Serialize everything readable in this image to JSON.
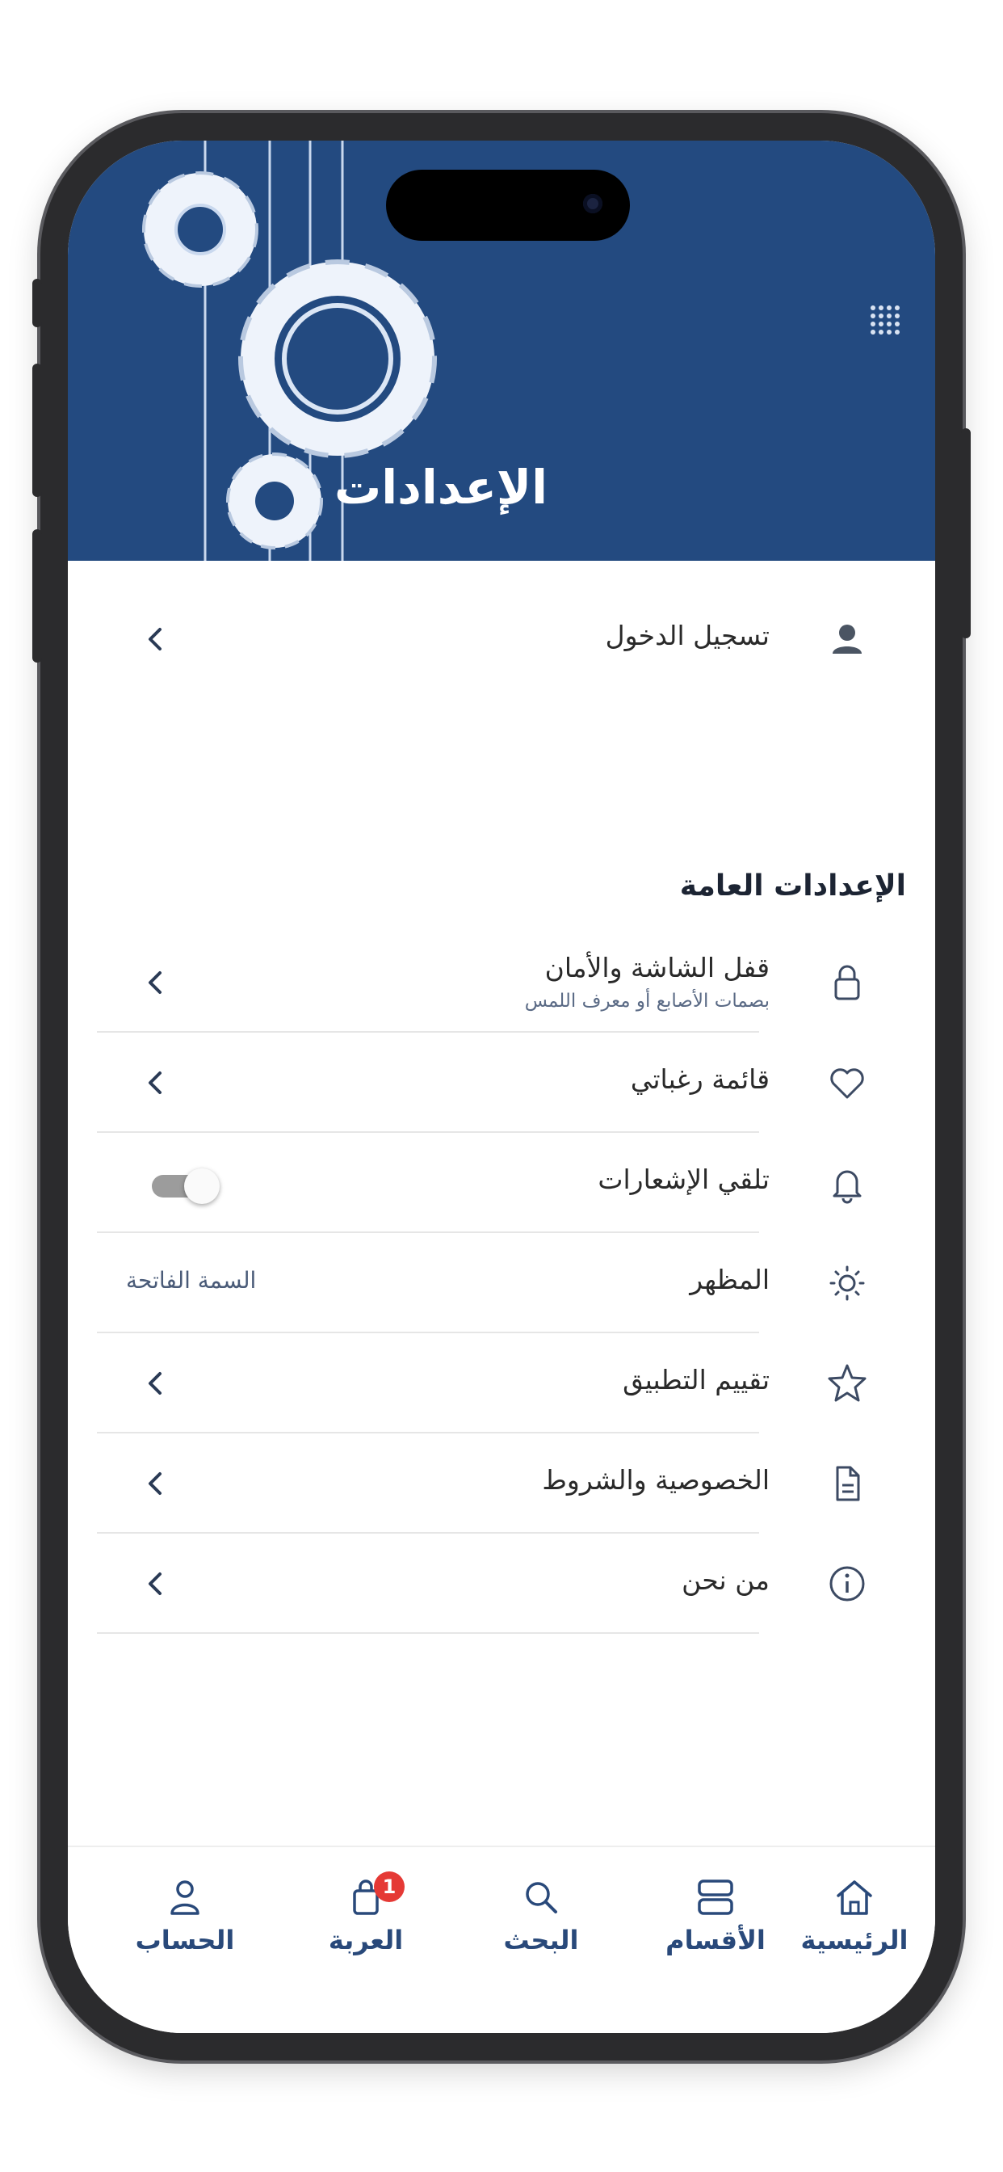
{
  "header": {
    "title": "الإعدادات"
  },
  "account_row": {
    "label": "تسجيل الدخول",
    "icon": "person-icon"
  },
  "general_section": {
    "title": "الإعدادات العامة",
    "items": [
      {
        "label": "قفل الشاشة والأمان",
        "subtitle": "بصمات الأصابع أو معرف اللمس",
        "icon": "lock-icon",
        "trailing": "chevron"
      },
      {
        "label": "قائمة رغباتي",
        "icon": "heart-icon",
        "trailing": "chevron"
      },
      {
        "label": "تلقي الإشعارات",
        "icon": "bell-icon",
        "trailing": "toggle",
        "toggle_on": false
      },
      {
        "label": "المظهر",
        "icon": "sun-icon",
        "trailing": "value",
        "value": "السمة الفاتحة"
      },
      {
        "label": "تقييم التطبيق",
        "icon": "star-icon",
        "trailing": "chevron"
      },
      {
        "label": "الخصوصية والشروط",
        "icon": "document-icon",
        "trailing": "chevron"
      },
      {
        "label": "من نحن",
        "icon": "info-icon",
        "trailing": "chevron"
      }
    ]
  },
  "tabbar": {
    "items": [
      {
        "label": "الحساب",
        "icon": "person-outline-icon"
      },
      {
        "label": "العربة",
        "icon": "shopping-bag-icon",
        "badge": "1"
      },
      {
        "label": "البحث",
        "icon": "search-icon"
      },
      {
        "label": "الأقسام",
        "icon": "categories-icon"
      },
      {
        "label": "الرئيسية",
        "icon": "home-icon"
      }
    ]
  },
  "colors": {
    "header_bg": "#234a80",
    "accent": "#29497a",
    "badge": "#e53935"
  }
}
